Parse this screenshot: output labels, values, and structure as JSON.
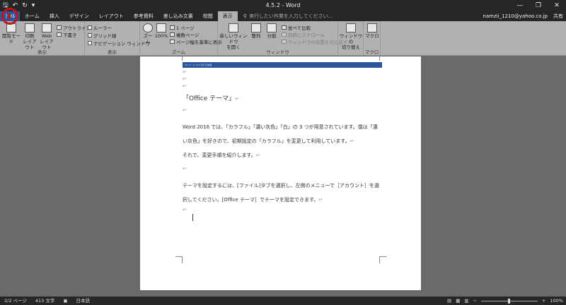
{
  "window": {
    "title": "4.5.2 - Word",
    "qat": {
      "save": "🖫",
      "undo": "↶",
      "redo": "↻",
      "customize": "▾"
    },
    "controls": {
      "minimize": "—",
      "restore": "❐",
      "close": "✕"
    }
  },
  "tabs": [
    {
      "label": "ﾌｧｲﾙ"
    },
    {
      "label": "ホーム"
    },
    {
      "label": "挿入"
    },
    {
      "label": "デザイン"
    },
    {
      "label": "レイアウト"
    },
    {
      "label": "参考資料"
    },
    {
      "label": "差し込み文書"
    },
    {
      "label": "校閲"
    },
    {
      "label": "表示"
    }
  ],
  "tell_me": {
    "placeholder": "実行したい作業を入力してください..."
  },
  "account": {
    "email": "namzii_1210@yahoo.co.jp",
    "share": "共有"
  },
  "ribbon": {
    "views": {
      "label": "表示",
      "read_mode": "閲覧モード",
      "print_layout_1": "印刷",
      "print_layout_2": "レイアウト",
      "web_layout_1": "Web",
      "web_layout_2": "レイアウト",
      "outline": "アウトライン",
      "draft": "下書き"
    },
    "show": {
      "label": "表示",
      "ruler": "ルーラー",
      "gridlines": "グリッド線",
      "nav_pane": "ナビゲーション ウィンドウ"
    },
    "zoom": {
      "label": "ズーム",
      "zoom": "ズーム",
      "hundred": "100%",
      "one_page": "1 ページ",
      "multi_page": "複数ページ",
      "page_width": "ページ幅を基準に表示"
    },
    "window": {
      "label": "ウィンドウ",
      "new_window_1": "新しいウィンドウ",
      "new_window_2": "を開く",
      "arrange": "整列",
      "split": "分割",
      "side_by_side": "並べて比較",
      "sync_scroll": "同時にスクロール",
      "reset_pos": "ウィンドウの位置を元に戻す",
      "switch_1": "ウィンドウの",
      "switch_2": "切り替え"
    },
    "macros": {
      "label": "マクロ",
      "macro": "マクロ"
    }
  },
  "document": {
    "embedded_caption": "2/2 ページ   413 文字   日本語",
    "heading": "「Office テーマ」",
    "p1_line1": "Word 2016 では、「カラフル」「濃い灰色」「白」の 3 つが用意されています。僕は「濃",
    "p1_line2": "い灰色」を好きので、初期設定の「カラフル」を変更して利用しています。",
    "p2": "それで、変更手順を紹介します。",
    "p3_line1": "テーマを設定するには、[ファイル]タブを選択し、左側のメニューで［アカウント］を選",
    "p3_line2": "択してください。[Office テーマ］でテーマを設定できます。",
    "para_mark": "↵"
  },
  "status": {
    "page": "2/2 ページ",
    "words": "413 文字",
    "language": "日本語",
    "zoom": "100%",
    "zoom_minus": "−",
    "zoom_plus": "+",
    "zoom_fraction": 0.5
  }
}
